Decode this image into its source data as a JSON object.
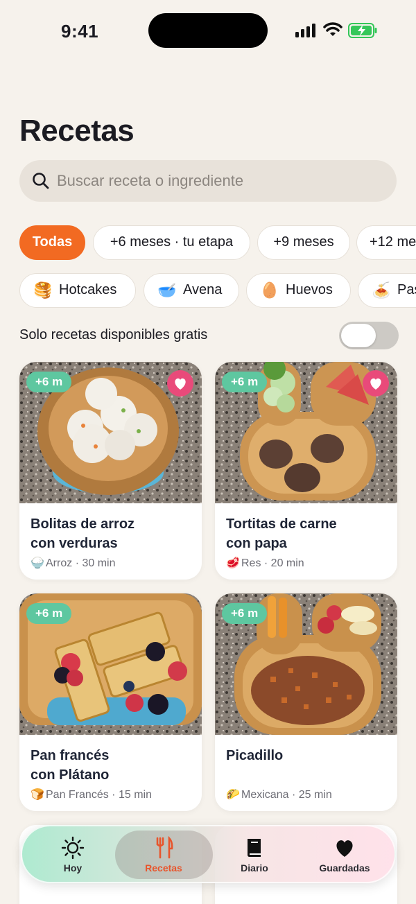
{
  "status_bar": {
    "time": "9:41"
  },
  "page": {
    "title": "Recetas"
  },
  "search": {
    "placeholder": "Buscar receta o ingrediente"
  },
  "age_filters": [
    {
      "label": "Todas",
      "selected": true
    },
    {
      "label": "+6 meses · tu etapa",
      "selected": false
    },
    {
      "label": "+9 meses",
      "selected": false
    },
    {
      "label": "+12 me",
      "selected": false
    }
  ],
  "food_filters": [
    {
      "label": "Hotcakes",
      "icon": "pancakes-icon",
      "emoji": "🥞"
    },
    {
      "label": "Avena",
      "icon": "oatmeal-bowl-icon",
      "emoji": "🥣"
    },
    {
      "label": "Huevos",
      "icon": "egg-icon",
      "emoji": "🥚"
    },
    {
      "label": "Pas",
      "icon": "pasta-icon",
      "emoji": "🍝"
    }
  ],
  "free_toggle": {
    "label": "Solo recetas disponibles gratis",
    "on": false
  },
  "recipes": [
    {
      "stage": "+6 m",
      "title_line1": "Bolitas de arroz",
      "title_line2": "con verduras",
      "ingredient": "Arroz",
      "ingredient_icon": "rice-icon",
      "ingredient_emoji": "🍚",
      "time": "· 30 min",
      "favorite": true
    },
    {
      "stage": "+6 m",
      "title_line1": "Tortitas de carne",
      "title_line2": "con papa",
      "ingredient": "Res",
      "ingredient_icon": "meat-icon",
      "ingredient_emoji": "🥩",
      "time": "· 20 min",
      "favorite": true
    },
    {
      "stage": "+6 m",
      "title_line1": "Pan francés",
      "title_line2": "con Plátano",
      "ingredient": "Pan Francés",
      "ingredient_icon": "bread-icon",
      "ingredient_emoji": "🍞",
      "time": "· 15 min",
      "favorite": false
    },
    {
      "stage": "+6 m",
      "title_line1": "Picadillo",
      "title_line2": "",
      "ingredient": "Mexicana",
      "ingredient_icon": "taco-icon",
      "ingredient_emoji": "🌮",
      "time": "· 25 min",
      "favorite": false
    }
  ],
  "bottom_nav": [
    {
      "label": "Hoy",
      "icon": "sun-icon",
      "active": false
    },
    {
      "label": "Recetas",
      "icon": "fork-knife-icon",
      "active": true
    },
    {
      "label": "Diario",
      "icon": "book-icon",
      "active": false
    },
    {
      "label": "Guardadas",
      "icon": "heart-icon",
      "active": false
    }
  ],
  "colors": {
    "accent": "#f26a22",
    "stage_badge": "#5ec7a0",
    "favorite": "#e94a7a",
    "background": "#f6f2ec"
  }
}
